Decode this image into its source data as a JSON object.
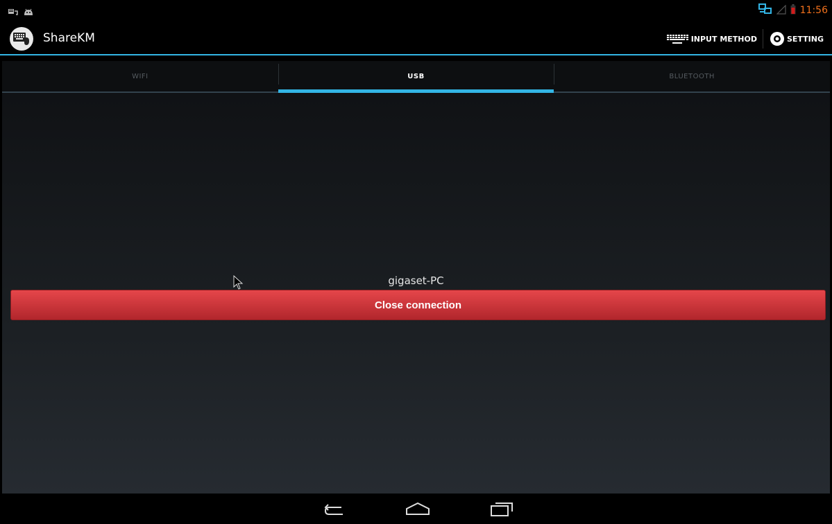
{
  "status_bar": {
    "time": "11:56",
    "colors": {
      "time": "#f2711c",
      "network": "#33b5e5",
      "battery": "#d11b1b"
    },
    "left_icons": [
      "usb-debug-icon",
      "android-icon"
    ],
    "right_icons": [
      "network-icon",
      "signal-icon",
      "battery-icon"
    ]
  },
  "action_bar": {
    "app_title": "ShareKM",
    "input_method_label": "INPUT METHOD",
    "setting_label": "SETTING"
  },
  "tabs": [
    {
      "label": "WIFI",
      "selected": false
    },
    {
      "label": "USB",
      "selected": true
    },
    {
      "label": "BLUETOOTH",
      "selected": false
    }
  ],
  "main": {
    "device_name": "gigaset-PC",
    "close_button_label": "Close connection"
  },
  "nav_bar": {
    "buttons": [
      "back-icon",
      "home-icon",
      "recent-apps-icon"
    ]
  },
  "colors": {
    "accent": "#33b5e5",
    "button_red": "#d93a3f"
  }
}
